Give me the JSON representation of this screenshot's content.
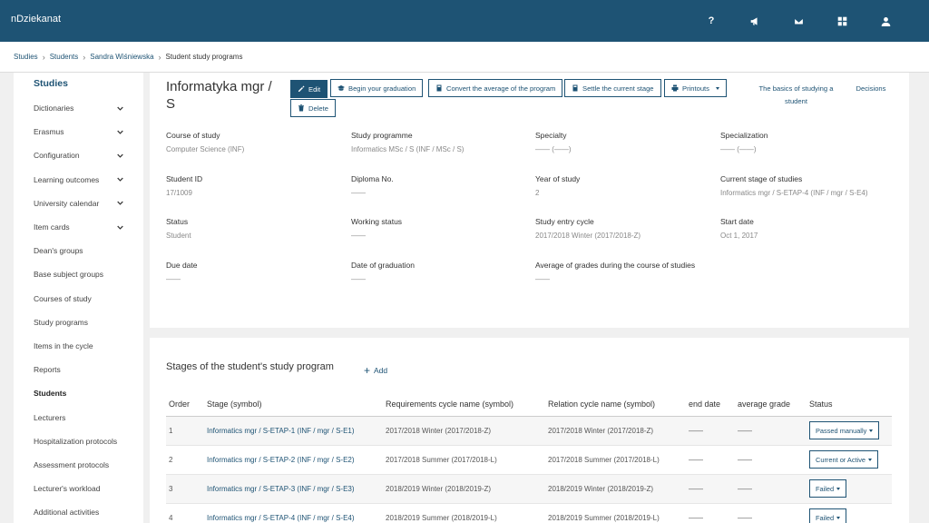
{
  "app": {
    "title": "nDziekanat"
  },
  "topbar": {
    "icons": [
      "help-icon",
      "megaphone-icon",
      "envelope-icon",
      "grid-icon",
      "user-icon"
    ],
    "help_label": "?"
  },
  "breadcrumb": {
    "items": [
      "Studies",
      "Students",
      "Sandra Wiśniewska"
    ],
    "current": "Student study programs"
  },
  "sidebar": {
    "title": "Studies",
    "items": [
      {
        "label": "Dictionaries",
        "expandable": true
      },
      {
        "label": "Erasmus",
        "expandable": true
      },
      {
        "label": "Configuration",
        "expandable": true
      },
      {
        "label": "Learning outcomes",
        "expandable": true
      },
      {
        "label": "University calendar",
        "expandable": true
      },
      {
        "label": "Item cards",
        "expandable": true
      },
      {
        "label": "Dean's groups"
      },
      {
        "label": "Base subject groups"
      },
      {
        "label": "Courses of study"
      },
      {
        "label": "Study programs"
      },
      {
        "label": "Items in the cycle"
      },
      {
        "label": "Reports"
      },
      {
        "label": "Students",
        "active": true
      },
      {
        "label": "Lecturers"
      },
      {
        "label": "Hospitalization protocols"
      },
      {
        "label": "Assessment protocols"
      },
      {
        "label": "Lecturer's workload"
      },
      {
        "label": "Additional activities"
      }
    ]
  },
  "program": {
    "title": "Informatyka mgr / S",
    "buttons": {
      "edit": "Edit",
      "delete": "Delete",
      "graduation": "Begin your graduation",
      "convert": "Convert the average of the program",
      "settle": "Settle the current stage",
      "printouts": "Printouts"
    },
    "links": {
      "basics": "The basics of studying a student",
      "decisions": "Decisions"
    },
    "fields": [
      {
        "label": "Course of study",
        "value": "Computer Science (INF)"
      },
      {
        "label": "Study programme",
        "value": "Informatics MSc / S (INF / MSc / S)"
      },
      {
        "label": "Specialty",
        "value": "—— (——)"
      },
      {
        "label": "Specialization",
        "value": "—— (——)"
      },
      {
        "label": "Student ID",
        "value": "17/1009"
      },
      {
        "label": "Diploma No.",
        "value": "——"
      },
      {
        "label": "Year of study",
        "value": "2"
      },
      {
        "label": "Current stage of studies",
        "value": "Informatics mgr / S-ETAP-4 (INF / mgr / S-E4)"
      },
      {
        "label": "Status",
        "value": "Student"
      },
      {
        "label": "Working status",
        "value": "——"
      },
      {
        "label": "Study entry cycle",
        "value": "2017/2018 Winter (2017/2018-Z)"
      },
      {
        "label": "Start date",
        "value": "Oct 1, 2017"
      },
      {
        "label": "Due date",
        "value": "——"
      },
      {
        "label": "Date of graduation",
        "value": "——"
      },
      {
        "label": "Average of grades during the course of studies",
        "value": "——"
      }
    ]
  },
  "stages": {
    "title": "Stages of the student's study program",
    "add_label": "Add",
    "columns": [
      "Order",
      "Stage (symbol)",
      "Requirements cycle name (symbol)",
      "Relation cycle name (symbol)",
      "end date",
      "average grade",
      "Status"
    ],
    "rows": [
      {
        "order": "1",
        "stage": "Informatics mgr / S-ETAP-1 (INF / mgr / S-E1)",
        "req": "2017/2018 Winter (2017/2018-Z)",
        "rel": "2017/2018 Winter (2017/2018-Z)",
        "end": "——",
        "avg": "——",
        "status": "Passed manually"
      },
      {
        "order": "2",
        "stage": "Informatics mgr / S-ETAP-2 (INF / mgr / S-E2)",
        "req": "2017/2018 Summer (2017/2018-L)",
        "rel": "2017/2018 Summer (2017/2018-L)",
        "end": "——",
        "avg": "——",
        "status": "Current or Active"
      },
      {
        "order": "3",
        "stage": "Informatics mgr / S-ETAP-3 (INF / mgr / S-E3)",
        "req": "2018/2019 Winter (2018/2019-Z)",
        "rel": "2018/2019 Winter (2018/2019-Z)",
        "end": "——",
        "avg": "——",
        "status": "Failed"
      },
      {
        "order": "4",
        "stage": "Informatics mgr / S-ETAP-4 (INF / mgr / S-E4)",
        "req": "2018/2019 Summer (2018/2019-L)",
        "rel": "2018/2019 Summer (2018/2019-L)",
        "end": "——",
        "avg": "——",
        "status": "Failed"
      }
    ]
  }
}
